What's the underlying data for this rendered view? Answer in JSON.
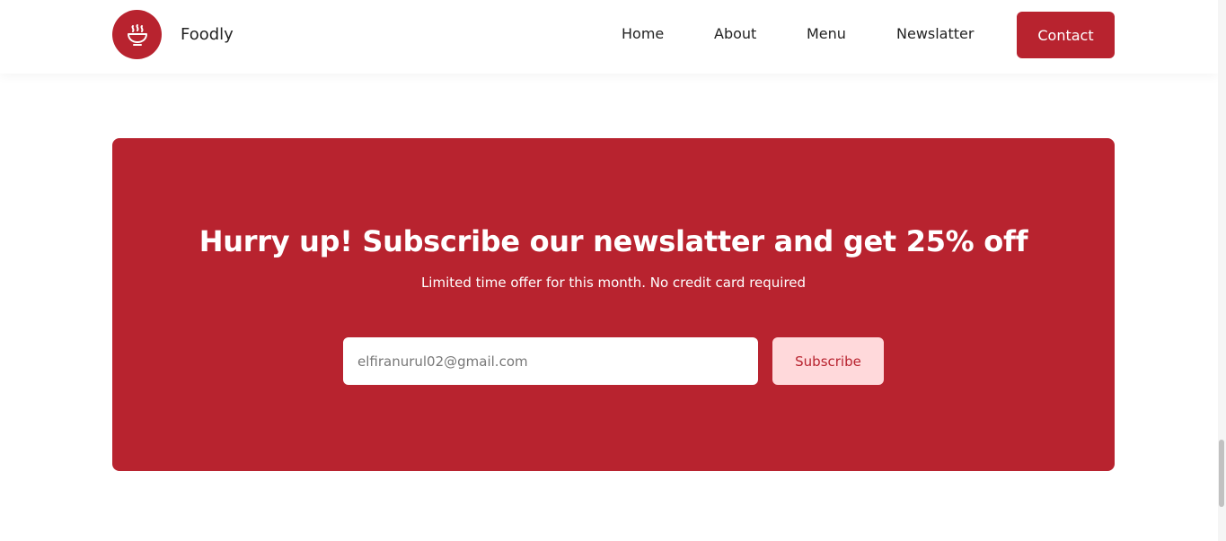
{
  "header": {
    "brand": "Foodly",
    "logo_icon": "bowl-steam-icon",
    "nav": [
      {
        "label": "Home"
      },
      {
        "label": "About"
      },
      {
        "label": "Menu"
      },
      {
        "label": "Newslatter"
      }
    ],
    "contact_label": "Contact"
  },
  "newsletter": {
    "headline": "Hurry up! Subscribe our newslatter and get 25% off",
    "subline": "Limited time offer for this month. No credit card required",
    "email_placeholder": "elfiranurul02@gmail.com",
    "subscribe_label": "Subscribe"
  },
  "colors": {
    "brand": "#b8232f",
    "button_light": "#ffd9db"
  }
}
